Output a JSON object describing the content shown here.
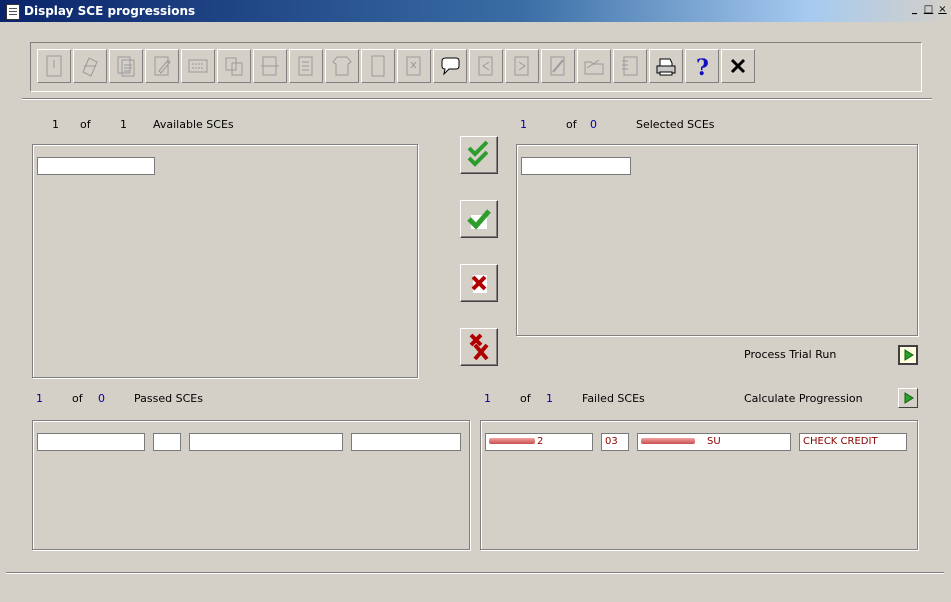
{
  "window": {
    "title": "Display SCE progressions",
    "controls": [
      "_",
      "□",
      "×"
    ]
  },
  "toolbar": {
    "buttons": [
      {
        "name": "new-record",
        "enabled": false
      },
      {
        "name": "edit-record",
        "enabled": false
      },
      {
        "name": "copy-record",
        "enabled": false
      },
      {
        "name": "edit-form",
        "enabled": false
      },
      {
        "name": "keyboard",
        "enabled": false
      },
      {
        "name": "insert-form",
        "enabled": false
      },
      {
        "name": "delete-form",
        "enabled": false
      },
      {
        "name": "duplicate-form",
        "enabled": false
      },
      {
        "name": "shirt-form",
        "enabled": false
      },
      {
        "name": "blank-page",
        "enabled": false
      },
      {
        "name": "note-page",
        "enabled": false
      },
      {
        "name": "comment",
        "enabled": true
      },
      {
        "name": "previous-form",
        "enabled": false
      },
      {
        "name": "next-form",
        "enabled": false
      },
      {
        "name": "edit-pen",
        "enabled": false
      },
      {
        "name": "open-folder",
        "enabled": false
      },
      {
        "name": "checklist",
        "enabled": false
      },
      {
        "name": "print",
        "enabled": true
      },
      {
        "name": "help",
        "enabled": true
      },
      {
        "name": "close",
        "enabled": true
      }
    ]
  },
  "available": {
    "current": "1",
    "of": "of",
    "total": "1",
    "label": "Available SCEs"
  },
  "selected": {
    "current": "1",
    "of": "of",
    "total": "0",
    "label": "Selected SCEs"
  },
  "passed": {
    "current": "1",
    "of": "of",
    "total": "0",
    "label": "Passed SCEs"
  },
  "failed": {
    "current": "1",
    "of": "of",
    "total": "1",
    "label": "Failed SCEs",
    "row": {
      "code": "2",
      "year": "03",
      "status": "SU",
      "reason": "CHECK CREDIT"
    }
  },
  "actions": {
    "process_trial_run": "Process Trial Run",
    "calculate_progression": "Calculate Progression"
  },
  "colors": {
    "accent_title": "#0a246a",
    "check_green": "#2e9d2e",
    "cross_red": "#b00000",
    "play_green": "#28a428"
  }
}
